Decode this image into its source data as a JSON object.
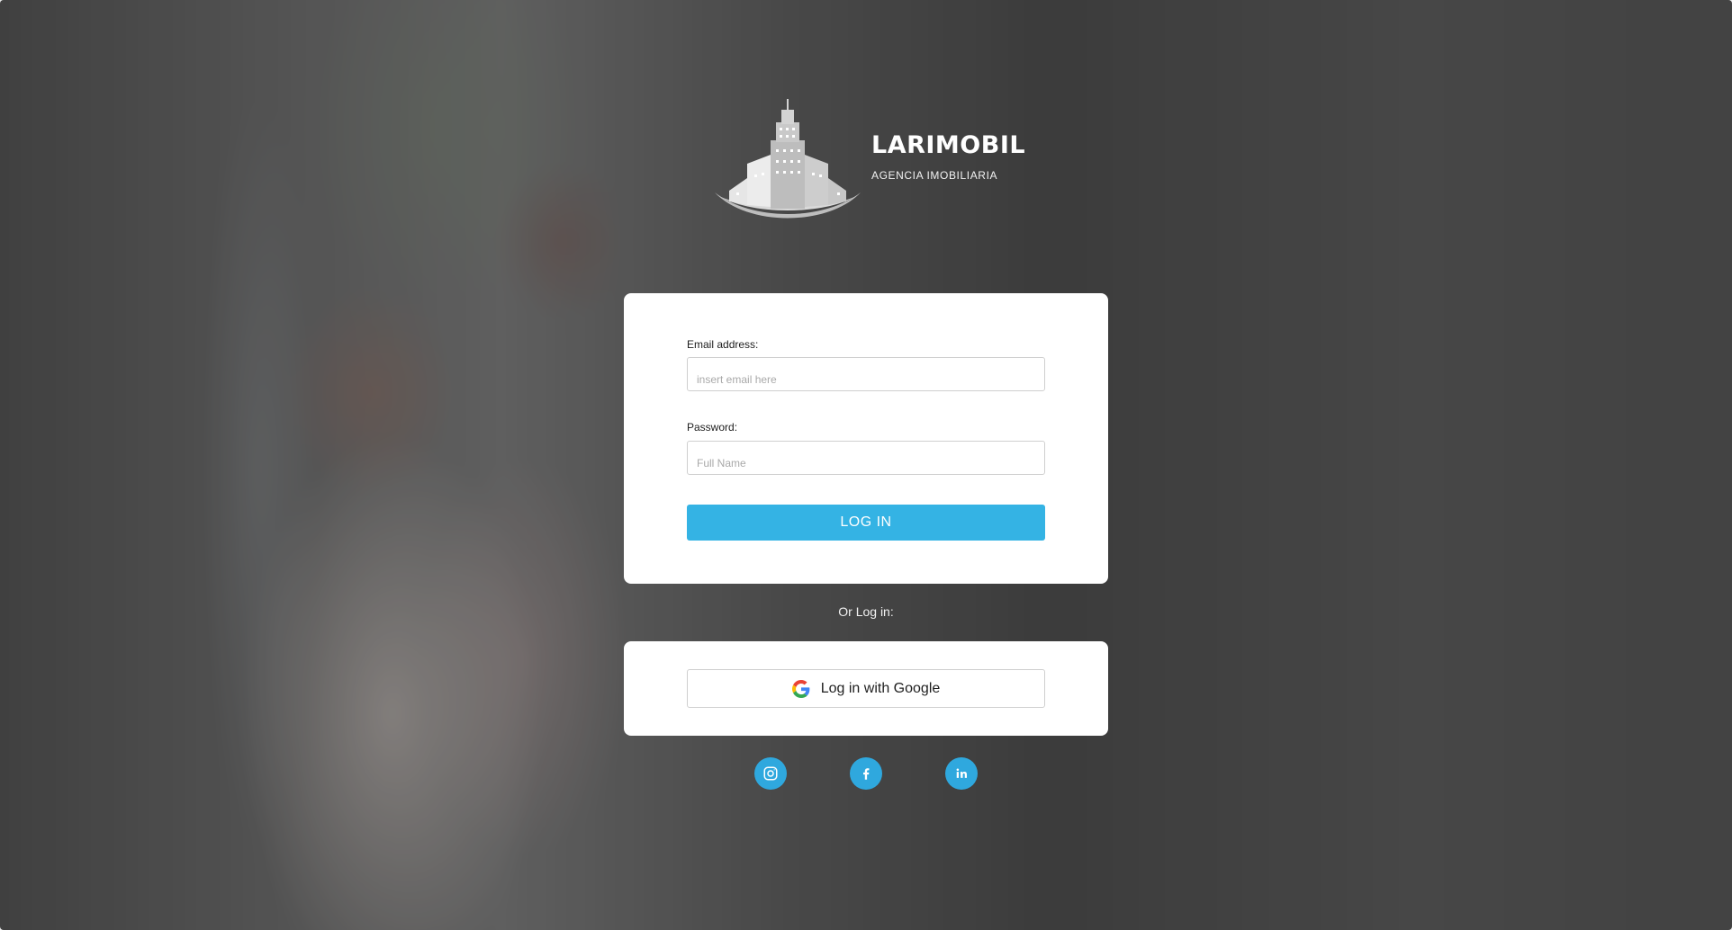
{
  "brand": {
    "name": "LARIMOBIL",
    "tagline": "AGENCIA IMOBILIARIA"
  },
  "login_form": {
    "email_label": "Email address:",
    "email_placeholder": "insert email here",
    "password_label": "Password:",
    "password_placeholder": "Full Name",
    "submit_label": "LOG IN"
  },
  "alt_login": {
    "divider_text": "Or Log in:",
    "google_label": "Log in with Google"
  },
  "social_links": [
    {
      "icon": "instagram-icon"
    },
    {
      "icon": "facebook-icon"
    },
    {
      "icon": "linkedin-icon"
    }
  ],
  "colors": {
    "accent": "#34b3e4",
    "social": "#2fa8de",
    "card": "#ffffff"
  }
}
